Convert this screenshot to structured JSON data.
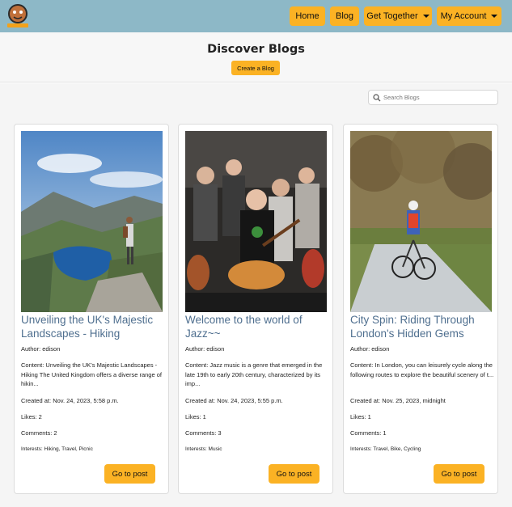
{
  "nav": {
    "logo_icon": "paw-logo-icon",
    "home": "Home",
    "blog": "Blog",
    "get_together": "Get Together",
    "my_account": "My Account"
  },
  "hero": {
    "title": "Discover Blogs",
    "create_label": "Create a Blog"
  },
  "search": {
    "placeholder": "Search Blogs"
  },
  "colors": {
    "navbar": "#8db8c7",
    "accent": "#fbb224",
    "title_link": "#4f6f8f"
  },
  "posts": [
    {
      "title": "Unveiling the UK's Majestic Landscapes - Hiking",
      "author": "Author: edison",
      "content": "Content: Unveiling the UK's Majestic Landscapes - Hiking The United Kingdom offers a diverse range of hikin...",
      "created": "Created at: Nov. 24, 2023, 5:58 p.m.",
      "likes": "Likes: 2",
      "comments": "Comments: 2",
      "interests": "Interests: Hiking, Travel, Picnic",
      "button": "Go to post"
    },
    {
      "title": "Welcome to the world of Jazz~~",
      "author": "Author: edison",
      "content": "Content: Jazz music is a genre that emerged in the late 19th to early 20th century, characterized by its imp...",
      "created": "Created at: Nov. 24, 2023, 5:55 p.m.",
      "likes": "Likes: 1",
      "comments": "Comments: 3",
      "interests": "Interests: Music",
      "button": "Go to post"
    },
    {
      "title": "City Spin: Riding Through London's Hidden Gems",
      "author": "Author: edison",
      "content": "Content: In London, you can leisurely cycle along the following routes to explore the beautiful scenery of t...",
      "created": "Created at: Nov. 25, 2023, midnight",
      "likes": "Likes: 1",
      "comments": "Comments: 1",
      "interests": "Interests: Travel, Bike, Cycling",
      "button": "Go to post"
    }
  ]
}
